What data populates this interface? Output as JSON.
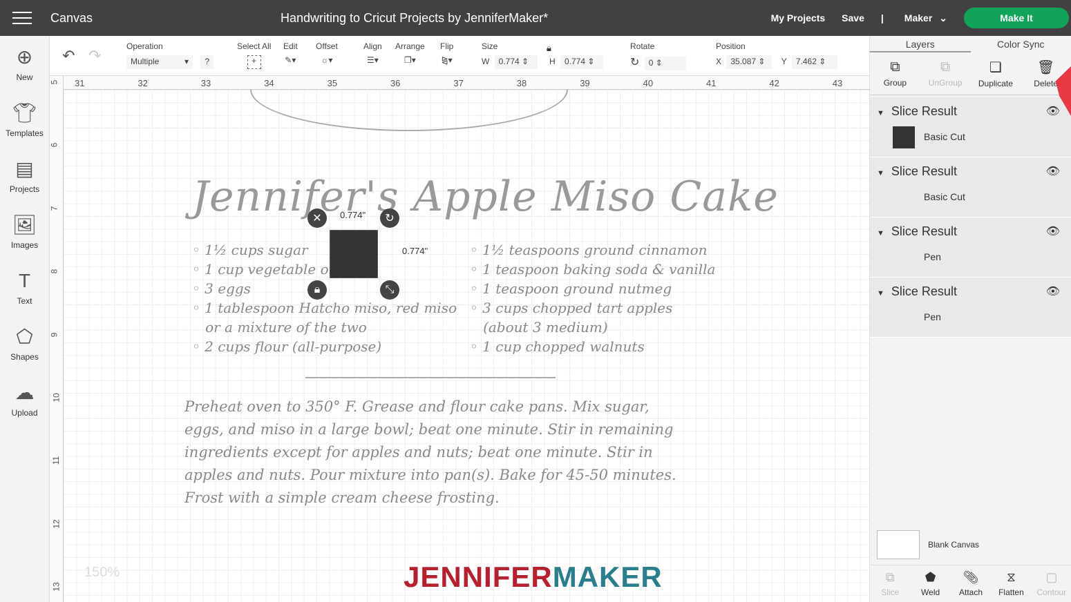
{
  "topbar": {
    "app_title": "Canvas",
    "doc_title": "Handwriting to Cricut Projects by JenniferMaker*",
    "my_projects": "My Projects",
    "save": "Save",
    "separator": "|",
    "machine": "Maker",
    "make_it": "Make It"
  },
  "toolbar": {
    "operation_label": "Operation",
    "operation_value": "Multiple",
    "help": "?",
    "select_all": "Select All",
    "edit": "Edit",
    "offset": "Offset",
    "align": "Align",
    "arrange": "Arrange",
    "flip": "Flip",
    "size_label": "Size",
    "w_label": "W",
    "w_value": "0.774",
    "h_label": "H",
    "h_value": "0.774",
    "rotate_label": "Rotate",
    "rotate_value": "0",
    "position_label": "Position",
    "x_label": "X",
    "x_value": "35.087",
    "y_label": "Y",
    "y_value": "7.462"
  },
  "sidebar": {
    "items": [
      {
        "label": "New",
        "icon": "plus-circle-icon"
      },
      {
        "label": "Templates",
        "icon": "tshirt-icon"
      },
      {
        "label": "Projects",
        "icon": "projects-icon"
      },
      {
        "label": "Images",
        "icon": "image-icon"
      },
      {
        "label": "Text",
        "icon": "text-icon"
      },
      {
        "label": "Shapes",
        "icon": "shapes-icon"
      },
      {
        "label": "Upload",
        "icon": "upload-icon"
      }
    ]
  },
  "ruler": {
    "top": [
      "31",
      "32",
      "33",
      "34",
      "35",
      "36",
      "37",
      "38",
      "39",
      "40",
      "41",
      "42",
      "43"
    ],
    "left": [
      "5",
      "6",
      "7",
      "8",
      "9",
      "10",
      "11",
      "12",
      "13"
    ]
  },
  "canvas": {
    "title": "Jennifer's Apple Miso Cake",
    "ingredients_left": [
      "1½ cups sugar",
      "1 cup vegetable oil",
      "3 eggs",
      "1 tablespoon Hatcho miso, red miso",
      "or a mixture of the two",
      "2 cups flour (all-purpose)"
    ],
    "ingredients_right": [
      "1½ teaspoons ground cinnamon",
      "1 teaspoon baking soda & vanilla",
      "1 teaspoon ground nutmeg",
      "3 cups chopped tart apples",
      "(about 3 medium)",
      "1 cup chopped walnuts"
    ],
    "instructions": "Preheat oven to 350° F. Grease and flour cake pans. Mix sugar, eggs, and miso in a large bowl; beat one minute. Stir in remaining ingredients except for apples and nuts; beat one minute. Stir in apples and nuts. Pour mixture into pan(s). Bake for 45-50 minutes. Frost with a simple cream cheese frosting.",
    "dim_w": "0.774\"",
    "dim_h": "0.774\"",
    "zoom": "150%",
    "logo_a": "JENNIFER",
    "logo_b": "MAKER",
    "logo_colors": {
      "a": "#b5202e",
      "b": "#2a7d8c"
    }
  },
  "panel": {
    "tabs": [
      "Layers",
      "Color Sync"
    ],
    "actions": [
      "Group",
      "UnGroup",
      "Duplicate",
      "Delete"
    ],
    "layers": [
      {
        "group": "Slice Result",
        "name": "Basic Cut",
        "swatch": "#333333"
      },
      {
        "group": "Slice Result",
        "name": "Basic Cut",
        "swatch": "#e9e9e9"
      },
      {
        "group": "Slice Result",
        "name": "Pen",
        "swatch": "#e9e9e9"
      },
      {
        "group": "Slice Result",
        "name": "Pen",
        "swatch": "#e9e9e9"
      }
    ],
    "blank_canvas": "Blank Canvas",
    "bottom": [
      "Slice",
      "Weld",
      "Attach",
      "Flatten",
      "Contour"
    ]
  },
  "colors": {
    "topbar": "#414042",
    "make_it": "#12a35a"
  }
}
